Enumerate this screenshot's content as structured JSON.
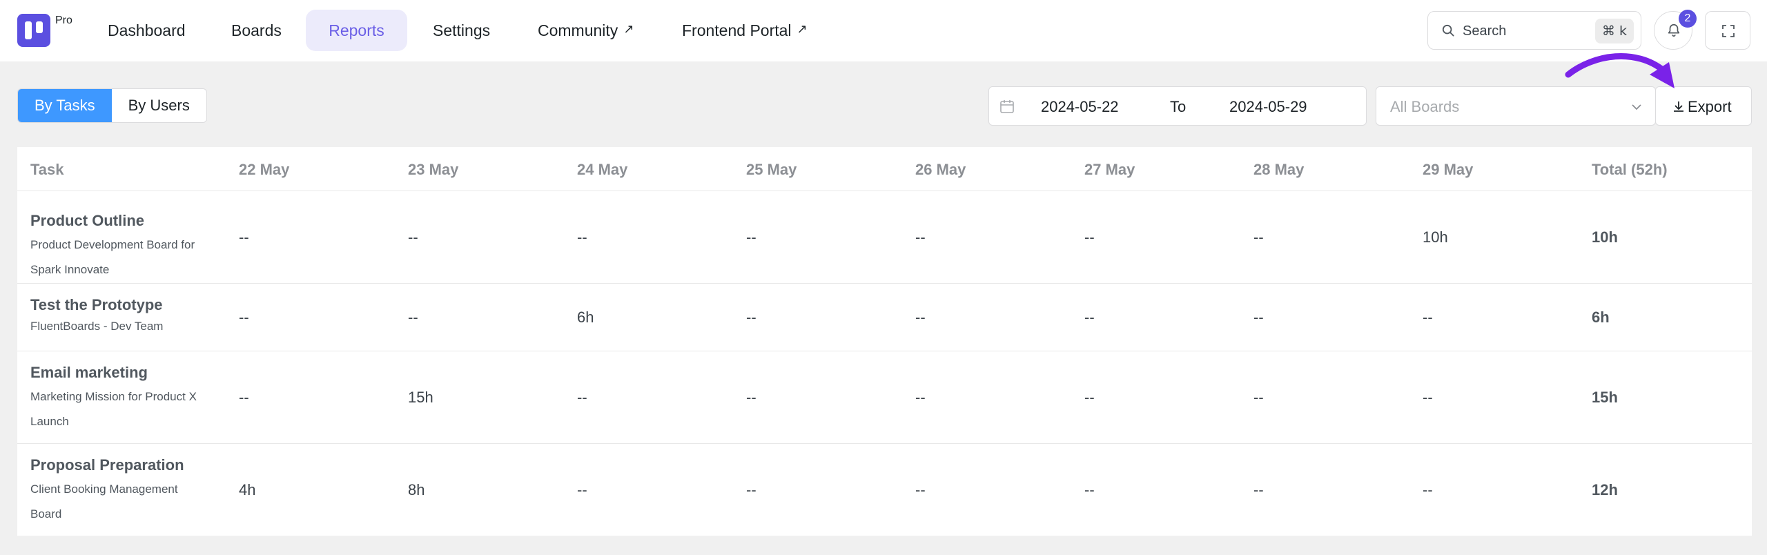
{
  "brand": {
    "badge": "Pro",
    "logo_icon": "fluent-boards-logo-icon",
    "color": "#5b4fe0"
  },
  "nav": {
    "items": [
      {
        "label": "Dashboard",
        "external": false
      },
      {
        "label": "Boards",
        "external": false
      },
      {
        "label": "Reports",
        "external": false,
        "active": true
      },
      {
        "label": "Settings",
        "external": false
      },
      {
        "label": "Community",
        "external": true
      },
      {
        "label": "Frontend Portal",
        "external": true
      }
    ],
    "external_glyph": "↗"
  },
  "search": {
    "label": "Search",
    "shortcut": "⌘ k"
  },
  "notifications": {
    "count": "2"
  },
  "toolbar": {
    "view_toggle": [
      {
        "label": "By Tasks",
        "active": true
      },
      {
        "label": "By Users",
        "active": false
      }
    ],
    "date_from": "2024-05-22",
    "date_separator": "To",
    "date_to": "2024-05-29",
    "boards_placeholder": "All Boards",
    "export_label": "Export"
  },
  "table": {
    "columns": [
      "Task",
      "22 May",
      "23 May",
      "24 May",
      "25 May",
      "26 May",
      "27 May",
      "28 May",
      "29 May",
      "Total (52h)"
    ],
    "rows": [
      {
        "title": "Product Outline",
        "board": "Product Development Board for Spark Innovate",
        "values": [
          "--",
          "--",
          "--",
          "--",
          "--",
          "--",
          "--",
          "10h"
        ],
        "total": "10h"
      },
      {
        "title": "Test the Prototype",
        "board": "FluentBoards - Dev Team",
        "values": [
          "--",
          "--",
          "6h",
          "--",
          "--",
          "--",
          "--",
          "--"
        ],
        "total": "6h"
      },
      {
        "title": "Email marketing",
        "board": "Marketing Mission for Product X Launch",
        "values": [
          "--",
          "15h",
          "--",
          "--",
          "--",
          "--",
          "--",
          "--"
        ],
        "total": "15h"
      },
      {
        "title": "Proposal Preparation",
        "board": "Client Booking Management Board",
        "values": [
          "4h",
          "8h",
          "--",
          "--",
          "--",
          "--",
          "--",
          "--"
        ],
        "total": "12h"
      }
    ]
  },
  "colors": {
    "accent": "#6a5ee6",
    "toggle_active": "#3e98ff",
    "annotation_arrow": "#7a22e8"
  }
}
